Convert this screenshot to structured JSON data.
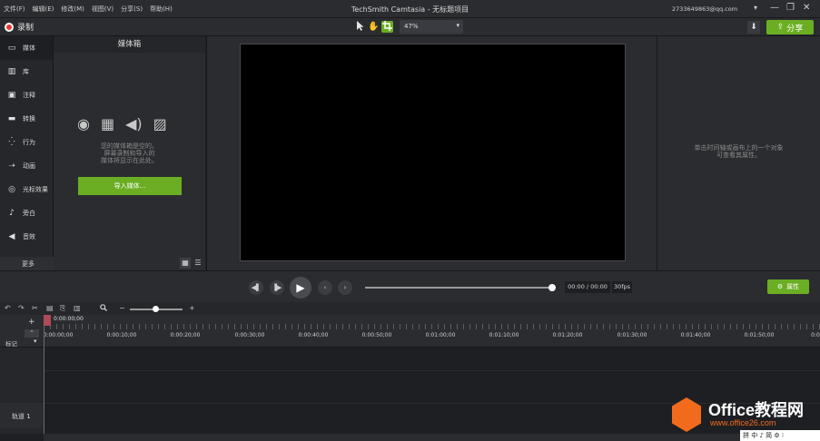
{
  "titlebar": {
    "menus": [
      "文件(F)",
      "编辑(E)",
      "修改(M)",
      "视图(V)",
      "分享(S)",
      "帮助(H)"
    ],
    "title": "TechSmith Camtasia - 无标题项目",
    "account": "2733649863@qq.com",
    "account_caret": "▾",
    "minimize": "—",
    "restore": "❐",
    "close": "✕"
  },
  "toolbar": {
    "record_label": "录制",
    "zoom_value": "47%",
    "download_icon": "⬇",
    "share_label": "分享",
    "share_icon": "⇪"
  },
  "sidebar": {
    "items": [
      {
        "label": "媒体",
        "icon": "▭"
      },
      {
        "label": "库",
        "icon": "▥"
      },
      {
        "label": "注释",
        "icon": "▣"
      },
      {
        "label": "转换",
        "icon": "▬"
      },
      {
        "label": "行为",
        "icon": "⁛"
      },
      {
        "label": "动画",
        "icon": "➝"
      },
      {
        "label": "光标效果",
        "icon": "◎"
      },
      {
        "label": "旁白",
        "icon": "♪"
      },
      {
        "label": "音效",
        "icon": "◀"
      }
    ],
    "more_label": "更多",
    "add": "+"
  },
  "media": {
    "header": "媒体箱",
    "icons": [
      "◉",
      "▦",
      "◀)",
      "▨"
    ],
    "empty_line1": "您的媒体箱是空的。",
    "empty_line2": "屏幕录制和导入的",
    "empty_line3": "媒体将显示在此处。",
    "import_label": "导入媒体...",
    "grid_view": "▦",
    "list_view": "☰"
  },
  "properties": {
    "empty_line1": "单击时间轴或画布上的一个对象",
    "empty_line2": "可查看其属性。",
    "button_label": "属性",
    "button_icon": "⚙"
  },
  "transport": {
    "step_back": "◀▌",
    "step_fwd": "▐▶",
    "play": "▶",
    "prev": "‹",
    "next": "›",
    "timecode": "00:00 / 00:00",
    "fps": "30fps"
  },
  "timeline": {
    "tools": [
      "↶",
      "↷",
      "✂",
      "▤",
      "⎘",
      "▥"
    ],
    "zoom_icon": "🔍",
    "zoom_minus": "−",
    "zoom_plus": "+",
    "playhead_time": "0:00:00;00",
    "add_track": "+",
    "collapse": "⌃",
    "ruler_labels": [
      "0:00:00;00",
      "0:00:10;00",
      "0:00:20;00",
      "0:00:30;00",
      "0:00:40;00",
      "0:00:50;00",
      "0:01:00;00",
      "0:01:10;00",
      "0:01:20;00",
      "0:01:30;00",
      "0:01:40;00",
      "0:01:50;00",
      "0:0"
    ],
    "marker_label": "标记",
    "marker_caret": "▾",
    "track_label": "轨道 1"
  },
  "watermark": {
    "title": "Office教程网",
    "url": "www.office26.com"
  },
  "ime": "拼 中 ♪ 简 ⚙ ⁝",
  "colors": {
    "accent": "#6bae23",
    "record": "#e53935",
    "playhead": "#b04a58",
    "watermark": "#f26b1d"
  }
}
